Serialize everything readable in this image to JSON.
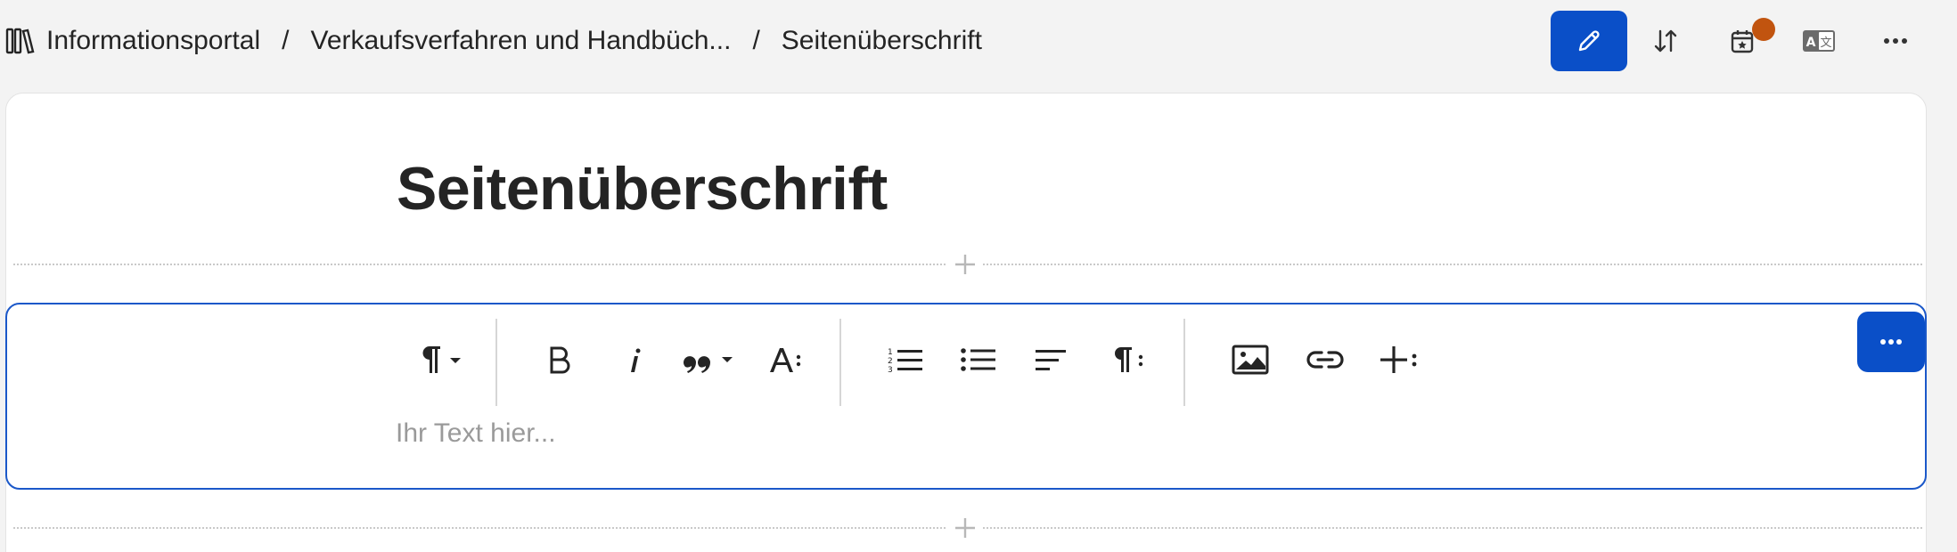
{
  "breadcrumb": {
    "items": [
      "Informationsportal",
      "Verkaufsverfahren und Handbüch...",
      "Seitenüberschrift"
    ],
    "separator": "/"
  },
  "header_actions": [
    {
      "name": "edit-button",
      "icon": "pencil-icon",
      "active": true
    },
    {
      "name": "sort-button",
      "icon": "sort-arrows-icon"
    },
    {
      "name": "schedule-button",
      "icon": "calendar-star-icon",
      "badge": true
    },
    {
      "name": "translate-button",
      "icon": "translate-icon"
    },
    {
      "name": "more-button",
      "icon": "ellipsis-icon"
    }
  ],
  "page": {
    "title": "Seitenüberschrift"
  },
  "editor": {
    "placeholder": "Ihr Text hier...",
    "toolbar": [
      "paragraph-style",
      "bold",
      "italic",
      "quote",
      "text-format",
      "numbered-list",
      "bullet-list",
      "align-left",
      "paragraph-more",
      "image",
      "link",
      "insert-more"
    ]
  },
  "colors": {
    "accent": "#0a4fc8",
    "badge": "#c1540f",
    "border_active": "#1b58c9"
  }
}
